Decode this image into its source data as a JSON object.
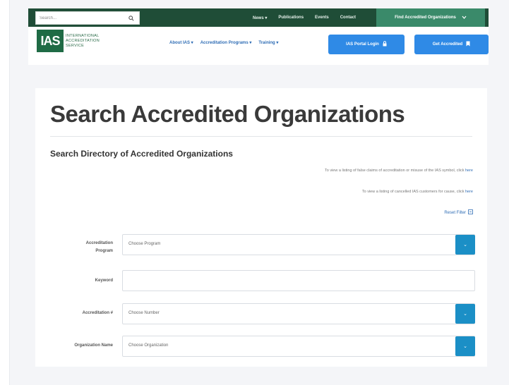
{
  "topbar": {
    "search_placeholder": "Search...",
    "links": [
      "News ▾",
      "Publications",
      "Events",
      "Contact"
    ],
    "find_button": "Find Accredited Organizations"
  },
  "header": {
    "logo_mark": "IAS",
    "logo_text": "International Accreditation Service",
    "nav": [
      "About IAS ▾",
      "Accreditation Programs ▾",
      "Training ▾"
    ],
    "portal_button": "IAS Portal Login",
    "accredited_button": "Get Accredited"
  },
  "main": {
    "title": "Search Accredited Organizations",
    "subtitle": "Search Directory of Accredited Organizations",
    "note1": "To view a listing of false claims of accreditation or misuse of the IAS symbol, click",
    "note2": "To view a listing of cancelled IAS customers for cause, click",
    "here": "here",
    "reset_filter": "Reset Filter",
    "fields": {
      "program_label_1": "Accreditation",
      "program_label_2": "Program",
      "program_value": "Choose Program",
      "keyword_label": "Keyword",
      "number_label": "Accreditation #",
      "number_value": "Choose Number",
      "org_label": "Organization Name",
      "org_value": "Choose Organization"
    }
  },
  "colors": {
    "topbar": "#1f4d37",
    "accent_blue": "#2f8ae6",
    "select_button": "#1b8fc6",
    "logo_green": "#1f6b45"
  }
}
